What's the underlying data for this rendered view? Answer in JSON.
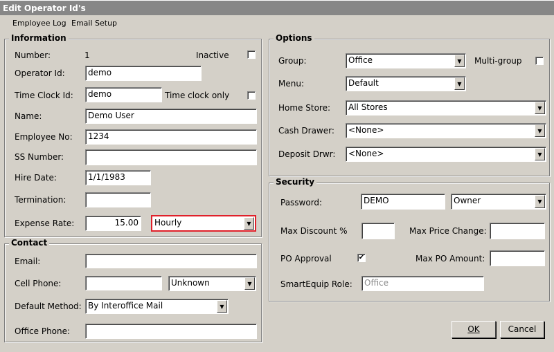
{
  "window": {
    "title": "Edit Operator Id's"
  },
  "menu": [
    "Employee Log",
    "Email Setup"
  ],
  "information": {
    "title": "Information",
    "number_label": "Number:",
    "number": "1",
    "inactive_label": "Inactive",
    "inactive": false,
    "operator_id_label": "Operator Id:",
    "operator_id": "demo",
    "time_clock_label": "Time Clock Id:",
    "time_clock_id": "demo",
    "time_clock_only_label": "Time clock only",
    "time_clock_only": false,
    "name_label": "Name:",
    "name": "Demo User",
    "employee_no_label": "Employee No:",
    "employee_no": "1234",
    "ss_label": "SS Number:",
    "ss": "",
    "hire_label": "Hire Date:",
    "hire": "1/1/1983",
    "termination_label": "Termination:",
    "termination": "",
    "expense_label": "Expense Rate:",
    "expense": "15.00",
    "rate_type": "Hourly"
  },
  "contact": {
    "title": "Contact",
    "email_label": "Email:",
    "email": "",
    "cell_label": "Cell Phone:",
    "cell": "",
    "cell_type": "Unknown",
    "method_label": "Default Method:",
    "method": "By Interoffice Mail",
    "office_label": "Office Phone:",
    "office": ""
  },
  "options": {
    "title": "Options",
    "group_label": "Group:",
    "group": "Office",
    "multi_label": "Multi-group",
    "multi": false,
    "menu_label": "Menu:",
    "menu": "Default",
    "store_label": "Home Store:",
    "store": "All Stores",
    "cash_label": "Cash Drawer:",
    "cash": "<None>",
    "deposit_label": "Deposit Drwr:",
    "deposit": "<None>"
  },
  "security": {
    "title": "Security",
    "password_label": "Password:",
    "password": "DEMO",
    "role": "Owner",
    "discount_label": "Max Discount %",
    "discount": "",
    "price_label": "Max Price Change:",
    "price": "",
    "po_label": "PO Approval",
    "po": true,
    "po_amount_label": "Max PO Amount:",
    "po_amount": "",
    "smart_label": "SmartEquip Role:",
    "smart": "Office"
  },
  "buttons": {
    "ok": "OK",
    "cancel": "Cancel"
  },
  "icons": {
    "check": "✔",
    "arrow": "▼"
  }
}
